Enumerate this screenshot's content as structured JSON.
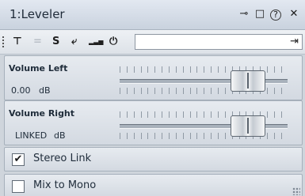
{
  "window": {
    "title": "1:Leveler",
    "controls": {
      "pin": "⊸",
      "restore": "□",
      "help": "?",
      "close": "✕"
    }
  },
  "toolbar": {
    "tools": [
      {
        "name": "top-align-tool",
        "glyph": "⊤"
      },
      {
        "name": "equal-tool",
        "glyph": "="
      },
      {
        "name": "s-tool",
        "glyph": "S"
      },
      {
        "name": "return-tool",
        "glyph": "⤶"
      },
      {
        "name": "meter-tool",
        "glyph": "▂▃▅"
      },
      {
        "name": "power-tool",
        "glyph": "⏻"
      }
    ],
    "preset_value": "",
    "preset_icon": "⇥"
  },
  "volume_left": {
    "label": "Volume Left",
    "value": "0.00",
    "unit": "dB",
    "level": 0.76
  },
  "volume_right": {
    "label": "Volume Right",
    "value": "LINKED",
    "unit": "dB",
    "level": 0.76
  },
  "stereo_link": {
    "label": "Stereo Link",
    "checked": true,
    "mark": "✔"
  },
  "mix_to_mono": {
    "label": "Mix to Mono",
    "checked": false,
    "mark": ""
  }
}
